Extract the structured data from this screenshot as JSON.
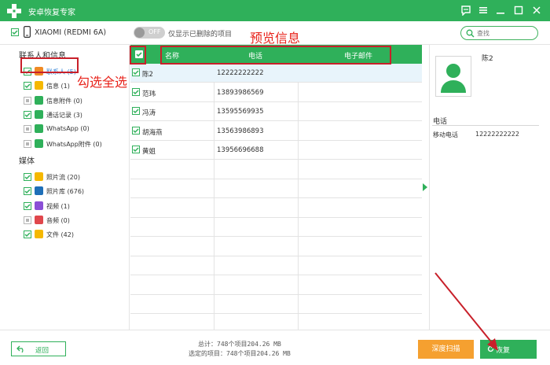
{
  "window": {
    "title": "安卓恢复专家",
    "accent_color": "#2fb05a"
  },
  "device": {
    "name": "XIAOMI (REDMI 6A)",
    "checked": true
  },
  "filter": {
    "toggle_state": "OFF",
    "label": "仅显示已删除的项目"
  },
  "search": {
    "placeholder": "查找"
  },
  "annotations": {
    "preview": "预览信息",
    "select_all": "勾选全选",
    "color": "#e8231b"
  },
  "sidebar": {
    "groups": [
      {
        "title": "联系人和信息",
        "items": [
          {
            "label": "联系人 (5)",
            "icon": "contact-icon",
            "icon_color": "#f08a24",
            "checked": true,
            "active": true
          },
          {
            "label": "信息 (1)",
            "icon": "message-icon",
            "icon_color": "#f5b800",
            "checked": true,
            "active": false
          },
          {
            "label": "信息附件 (0)",
            "icon": "attachment-icon",
            "icon_color": "#2fb05a",
            "checked": false,
            "active": false
          },
          {
            "label": "通话记录 (3)",
            "icon": "call-log-icon",
            "icon_color": "#2fb05a",
            "checked": true,
            "active": false
          },
          {
            "label": "WhatsApp (0)",
            "icon": "whatsapp-icon",
            "icon_color": "#2fb05a",
            "checked": false,
            "active": false
          },
          {
            "label": "WhatsApp附件 (0)",
            "icon": "whatsapp-attachment-icon",
            "icon_color": "#2fb05a",
            "checked": false,
            "active": false
          }
        ]
      },
      {
        "title": "媒体",
        "items": [
          {
            "label": "照片流 (20)",
            "icon": "photo-stream-icon",
            "icon_color": "#f5b800",
            "checked": true,
            "active": false
          },
          {
            "label": "照片库 (676)",
            "icon": "photo-library-icon",
            "icon_color": "#1e6fb8",
            "checked": true,
            "active": false
          },
          {
            "label": "视频 (1)",
            "icon": "video-icon",
            "icon_color": "#8a4fd6",
            "checked": true,
            "active": false
          },
          {
            "label": "音频 (0)",
            "icon": "audio-icon",
            "icon_color": "#e0474c",
            "checked": false,
            "active": false
          },
          {
            "label": "文件 (42)",
            "icon": "folder-icon",
            "icon_color": "#f5b800",
            "checked": true,
            "active": false
          }
        ]
      }
    ]
  },
  "table": {
    "columns": [
      "名称",
      "电话",
      "电子邮件"
    ],
    "header_checked": true,
    "rows": [
      {
        "name": "陈2",
        "phone": "12222222222",
        "email": "",
        "checked": true,
        "selected": true
      },
      {
        "name": "范玮",
        "phone": "13893986569",
        "email": "",
        "checked": true,
        "selected": false
      },
      {
        "name": "冯涛",
        "phone": "13595569935",
        "email": "",
        "checked": true,
        "selected": false
      },
      {
        "name": "胡海燕",
        "phone": "13563986893",
        "email": "",
        "checked": true,
        "selected": false
      },
      {
        "name": "黄姐",
        "phone": "13956696688",
        "email": "",
        "checked": true,
        "selected": false
      }
    ],
    "empty_rows": 9
  },
  "detail": {
    "name": "陈2",
    "section_title": "电话",
    "field_label": "移动电话",
    "field_value": "12222222222"
  },
  "footer": {
    "back_label": "返回",
    "total": "总计：748个项目204.26 MB",
    "selected": "选定的项目：748个项目204.26 MB",
    "deep_scan_label": "深度扫描",
    "restore_label": "恢复"
  }
}
